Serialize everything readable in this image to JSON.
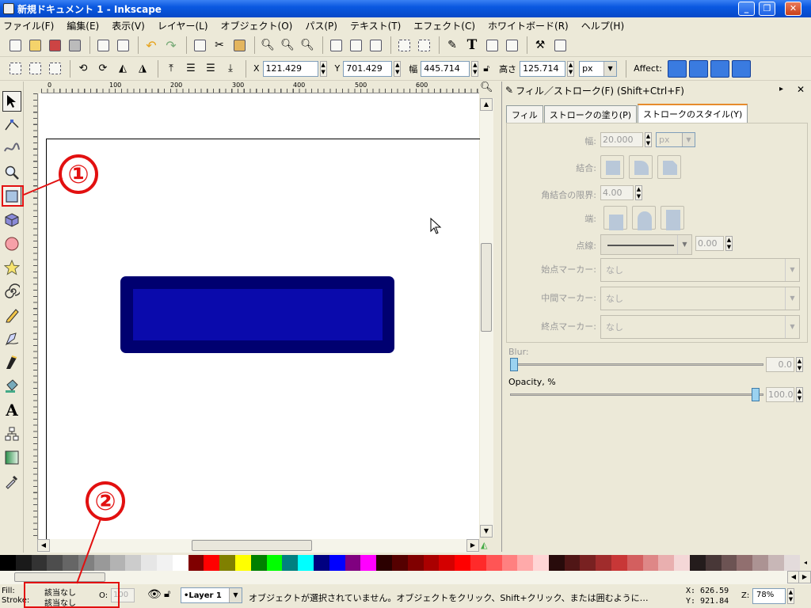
{
  "window": {
    "title": "新規ドキュメント 1 - Inkscape"
  },
  "menu": [
    "ファイル(F)",
    "編集(E)",
    "表示(V)",
    "レイヤー(L)",
    "オブジェクト(O)",
    "パス(P)",
    "テキスト(T)",
    "エフェクト(C)",
    "ホワイトボード(R)",
    "ヘルプ(H)"
  ],
  "controls": {
    "x_label": "X",
    "x_value": "121.429",
    "y_label": "Y",
    "y_value": "701.429",
    "w_label": "幅",
    "w_value": "445.714",
    "h_label": "高さ",
    "h_value": "125.714",
    "unit": "px",
    "affect_label": "Affect:"
  },
  "ruler": {
    "marks": [
      "0",
      "100",
      "200",
      "300",
      "400",
      "500",
      "600"
    ]
  },
  "dock": {
    "title": "フィル／ストローク(F) (Shift+Ctrl+F)",
    "tabs": [
      "フィル",
      "ストロークの塗り(P)",
      "ストロークのスタイル(Y)"
    ],
    "width_label": "幅:",
    "width_value": "20.000",
    "width_unit": "px",
    "join_label": "結合:",
    "miter_label": "角結合の限界:",
    "miter_value": "4.00",
    "cap_label": "端:",
    "dash_label": "点線:",
    "dash_value": "0.00",
    "start_marker_label": "始点マーカー:",
    "start_marker_value": "なし",
    "mid_marker_label": "中間マーカー:",
    "mid_marker_value": "なし",
    "end_marker_label": "終点マーカー:",
    "end_marker_value": "なし",
    "blur_label": "Blur:",
    "blur_value": "0.0",
    "opacity_label": "Opacity, %",
    "opacity_value": "100.0"
  },
  "palette": [
    "#000000",
    "#1a1a1a",
    "#333333",
    "#4d4d4d",
    "#666666",
    "#808080",
    "#999999",
    "#b3b3b3",
    "#cccccc",
    "#e6e6e6",
    "#f2f2f2",
    "#ffffff",
    "#800000",
    "#ff0000",
    "#808000",
    "#ffff00",
    "#008000",
    "#00ff00",
    "#008080",
    "#00ffff",
    "#000080",
    "#0000ff",
    "#800080",
    "#ff00ff",
    "#2b0000",
    "#550000",
    "#800000",
    "#aa0000",
    "#d40000",
    "#ff0000",
    "#ff2a2a",
    "#ff5555",
    "#ff8080",
    "#ffaaaa",
    "#ffd5d5",
    "#280b0b",
    "#501616",
    "#782121",
    "#a02c2c",
    "#c83737",
    "#d35f5f",
    "#de8787",
    "#e9afaf",
    "#f4d7d7",
    "#241c1c",
    "#483737",
    "#6c5353",
    "#916f6f",
    "#ac9393",
    "#c8b7b7",
    "#e3dbdb"
  ],
  "status": {
    "fill_label": "Fill:",
    "fill_value": "該当なし",
    "stroke_label": "Stroke:",
    "stroke_value": "該当なし",
    "o_label": "O:",
    "o_value": "100",
    "layer": "•Layer 1",
    "message": "オブジェクトが選択されていません。オブジェクトをクリック、Shift+クリック、または囲むように…",
    "x_coord": "X:  626.59",
    "y_coord": "Y:  921.84",
    "zoom_label": "Z:",
    "zoom_value": "78%"
  },
  "annotations": {
    "one": "①",
    "two": "②"
  }
}
